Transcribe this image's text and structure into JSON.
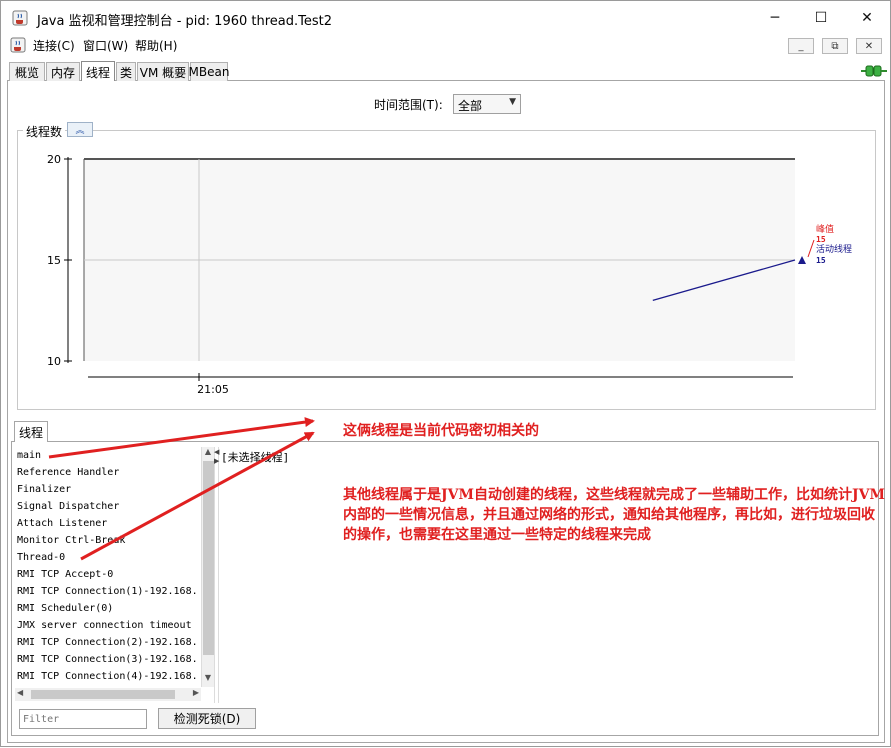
{
  "window": {
    "title": "Java 监视和管理控制台 - pid: 1960 thread.Test2",
    "controls": {
      "minimize": "─",
      "maximize": "☐",
      "close": "✕"
    }
  },
  "menubar": {
    "items": [
      "连接(C)",
      "窗口(W)",
      "帮助(H)"
    ],
    "mdi_controls": {
      "minimize": "_",
      "restore": "⧉",
      "close": "✕"
    }
  },
  "tabs": [
    {
      "label": "概览",
      "active": false
    },
    {
      "label": "内存",
      "active": false
    },
    {
      "label": "线程",
      "active": true
    },
    {
      "label": "类",
      "active": false
    },
    {
      "label": "VM 概要",
      "active": false
    },
    {
      "label": "MBean",
      "active": false
    }
  ],
  "time_range": {
    "label": "时间范围(T):",
    "value": "全部"
  },
  "chart_panel": {
    "title": "线程数",
    "collapse_icon": "double-chevron-up-icon"
  },
  "chart_data": {
    "type": "line",
    "x": [
      "21:05"
    ],
    "ylim": [
      10,
      20
    ],
    "yticks": [
      10,
      15,
      20
    ],
    "xticks": [
      "21:05"
    ],
    "grid": true,
    "series": [
      {
        "name": "峰值",
        "color": "#e02020",
        "current_value": 15
      },
      {
        "name": "活动线程",
        "color": "#1a1a8c",
        "current_value": 15,
        "points": [
          [
            0.8,
            13.0
          ],
          [
            1.0,
            15.0
          ]
        ]
      }
    ],
    "legend": {
      "peak_label": "峰值",
      "peak_value": "15",
      "live_label": "活动线程",
      "live_value": "15"
    }
  },
  "threads_panel": {
    "tab_label": "线程",
    "threads": [
      "main",
      "Reference Handler",
      "Finalizer",
      "Signal Dispatcher",
      "Attach Listener",
      "Monitor Ctrl-Break",
      "Thread-0",
      "RMI TCP Accept-0",
      "RMI TCP Connection(1)-192.168.",
      "RMI Scheduler(0)",
      "JMX server connection timeout",
      "RMI TCP Connection(2)-192.168.",
      "RMI TCP Connection(3)-192.168.",
      "RMI TCP Connection(4)-192.168."
    ],
    "detail_label": "[未选择线程]",
    "filter_placeholder": "Filter",
    "detect_button": "检测死锁(D)"
  },
  "annotations": {
    "note1": "这俩线程是当前代码密切相关的",
    "note2": "其他线程属于是JVM自动创建的线程，这些线程就完成了一些辅助工作，比如统计JVM内部的一些情况信息，并且通过网络的形式，通知给其他程序，再比如，进行垃圾回收的操作，也需要在这里通过一些特定的线程来完成",
    "color": "#e02020"
  }
}
